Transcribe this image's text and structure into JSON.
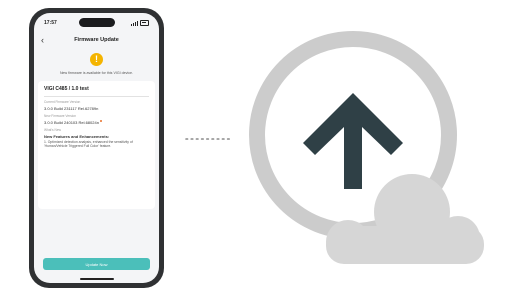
{
  "status_bar": {
    "time": "17:57"
  },
  "nav": {
    "back_icon": "chevron-left-icon",
    "title": "Firmware Update"
  },
  "notice": {
    "icon": "warning-icon",
    "text": "New firmware is available for this VIGI device."
  },
  "device": {
    "name": "VIGI C485 / 1.0 test"
  },
  "current_firmware": {
    "label": "Current Firmware Version",
    "value": "3.0.0 Build 231117 Rel.62789n"
  },
  "new_firmware": {
    "label": "New Firmware Version",
    "value": "3.0.0 Build 240103 Rel.68024n"
  },
  "whats_new": {
    "label": "What's New",
    "title": "New Features and Enhancements:",
    "body": "1. Optimized detection analysis, enhanced the sensitivity of 'Human/Vehicle Triggered Full Color' feature."
  },
  "actions": {
    "update_label": "Update Now"
  },
  "illustration": {
    "connector": "dotted-line",
    "icon": "cloud-upload-icon",
    "colors": {
      "ring": "#cccccc",
      "cloud": "#d6d6d6",
      "arrow": "#2f4046",
      "accent": "#4bbfba"
    }
  }
}
